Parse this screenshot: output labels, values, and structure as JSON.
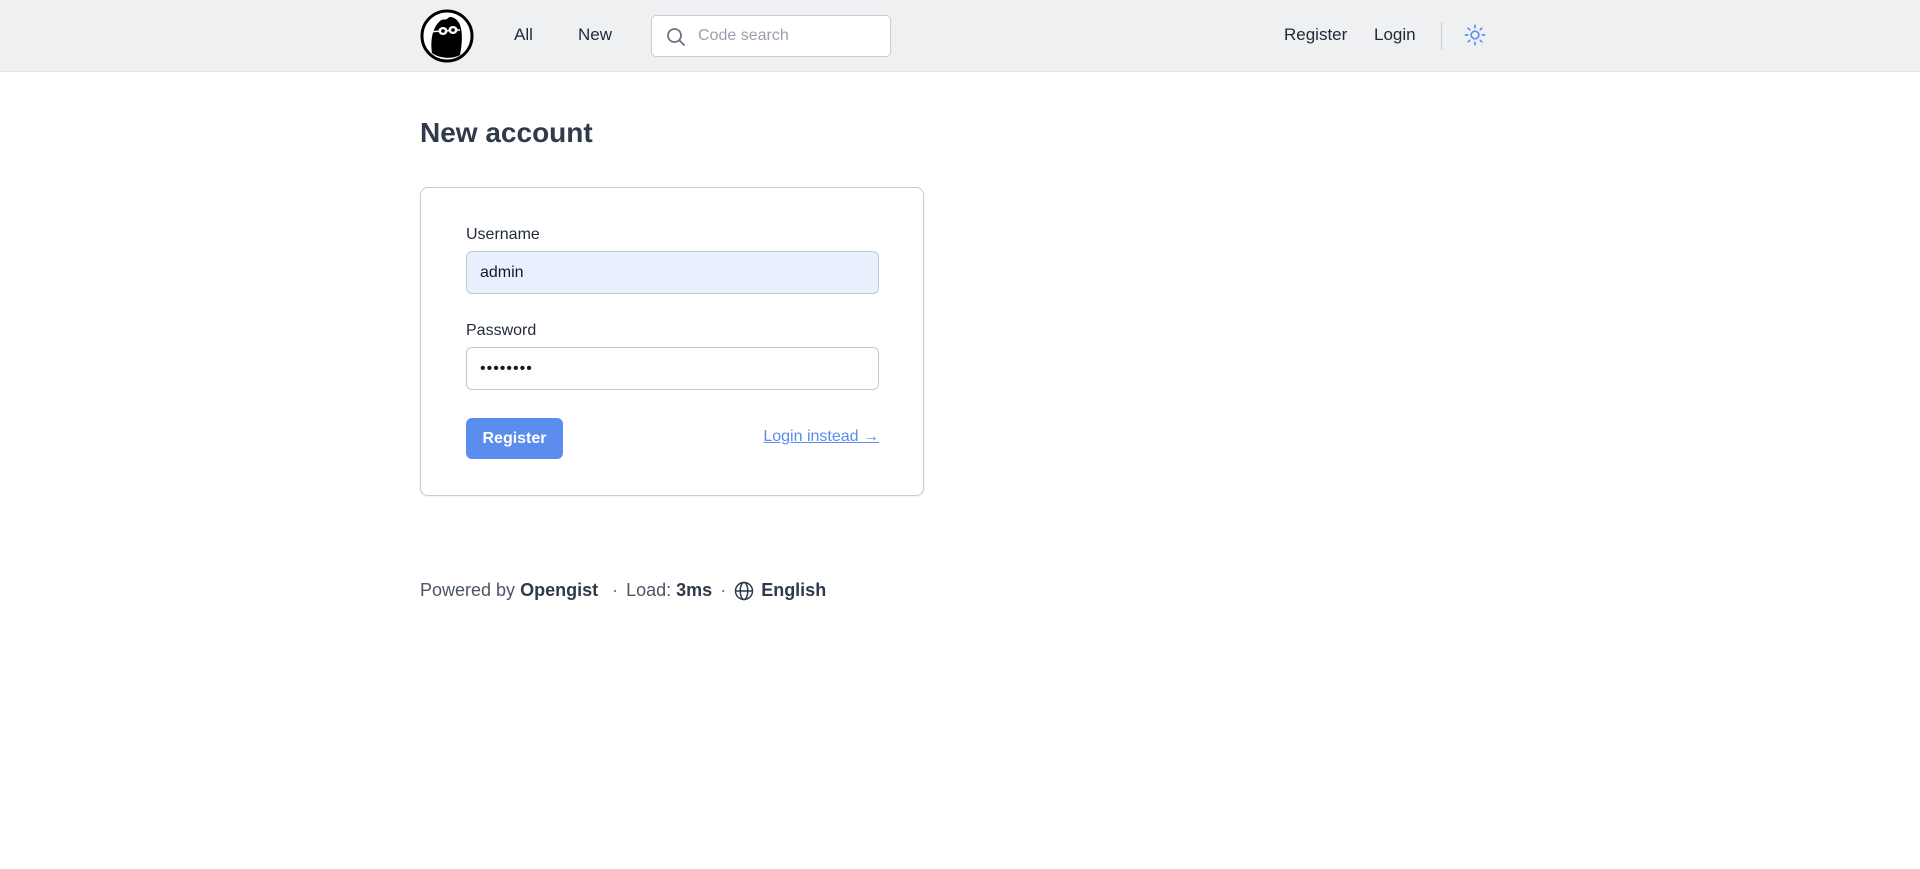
{
  "header": {
    "nav": [
      {
        "label": "All"
      },
      {
        "label": "New"
      }
    ],
    "search": {
      "placeholder": "Code search",
      "value": ""
    },
    "auth": [
      {
        "label": "Register"
      },
      {
        "label": "Login"
      }
    ]
  },
  "main": {
    "title": "New account",
    "form": {
      "username_label": "Username",
      "username_value": "admin",
      "password_label": "Password",
      "password_value": "••••••••",
      "submit_label": "Register",
      "alt_link_label": "Login instead →"
    }
  },
  "footer": {
    "powered_prefix": "Powered by",
    "brand": "Opengist",
    "separator": "·",
    "load_label": "Load:",
    "load_value": "3ms",
    "language": "English"
  },
  "colors": {
    "accent": "#5b8def",
    "topbar_bg": "#eff0f2",
    "autofill_bg": "#e8f0fe"
  },
  "icons": {
    "logo": "opengist-logo-icon",
    "search": "search-icon",
    "theme": "sun-icon",
    "language": "globe-icon"
  }
}
